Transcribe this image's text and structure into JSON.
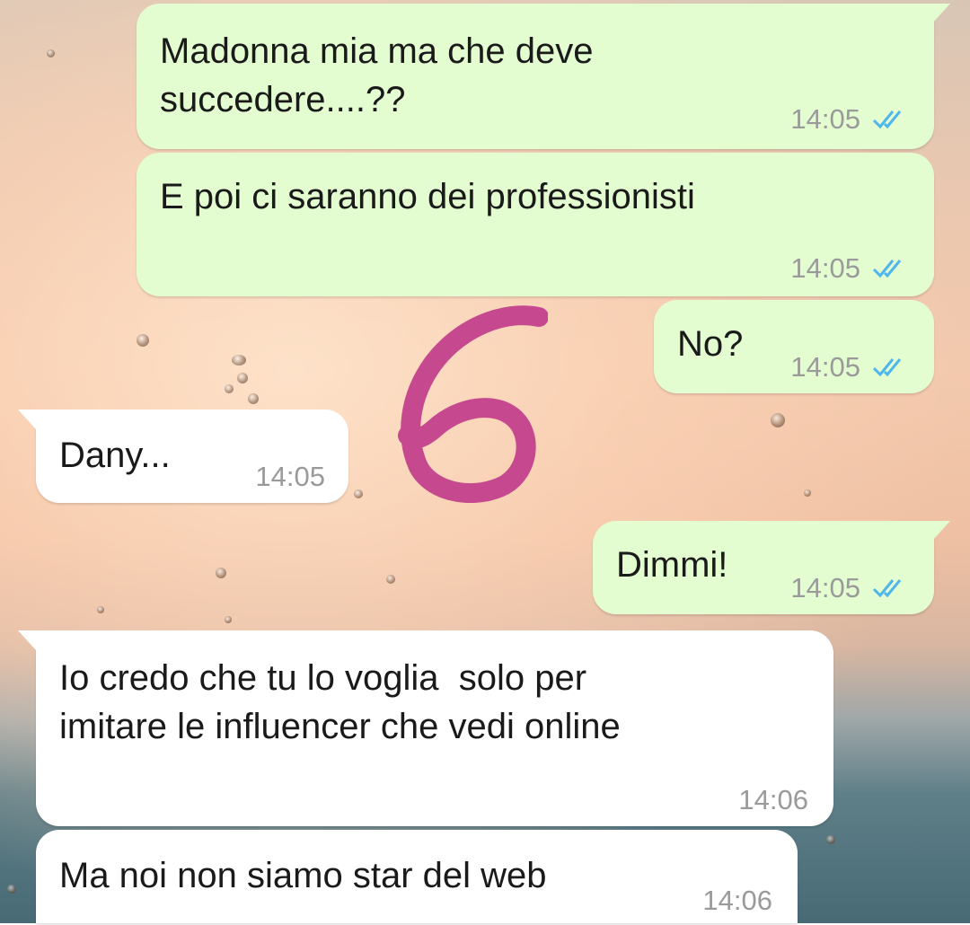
{
  "colors": {
    "outgoing_bubble": "#e3fdd1",
    "incoming_bubble": "#ffffff",
    "read_ticks": "#4fb6ec",
    "annotation": "#c6488f"
  },
  "annotation": {
    "label": "6"
  },
  "messages": [
    {
      "direction": "outgoing",
      "text": "Madonna mia ma che deve\nsuccedere....??",
      "time": "14:05",
      "status_icon": "double-check-read-icon"
    },
    {
      "direction": "outgoing",
      "text": "E poi ci saranno dei professionisti",
      "time": "14:05",
      "status_icon": "double-check-read-icon"
    },
    {
      "direction": "outgoing",
      "text": "No?",
      "time": "14:05",
      "status_icon": "double-check-read-icon"
    },
    {
      "direction": "incoming",
      "text": "Dany...",
      "time": "14:05"
    },
    {
      "direction": "outgoing",
      "text": "Dimmi!",
      "time": "14:05",
      "status_icon": "double-check-read-icon"
    },
    {
      "direction": "incoming",
      "text": "Io credo che tu lo voglia  solo per\nimitare le influencer che vedi online",
      "time": "14:06"
    },
    {
      "direction": "incoming",
      "text": "Ma noi non siamo star del web",
      "time": "14:06"
    }
  ]
}
